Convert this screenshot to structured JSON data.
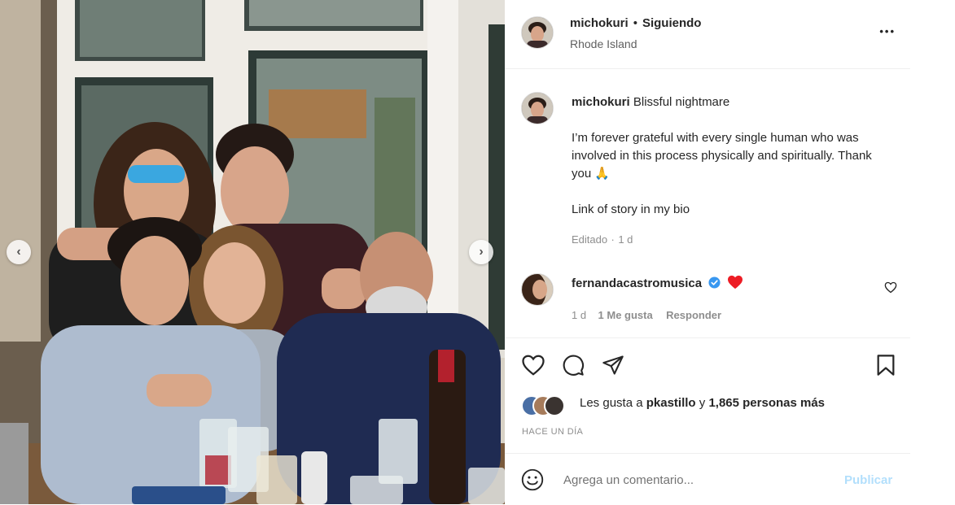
{
  "post": {
    "header": {
      "username": "michokuri",
      "separator": "•",
      "follow_status": "Siguiendo",
      "location": "Rhode Island",
      "more_icon": "more-horizontal-icon",
      "more_label": "•••"
    },
    "caption": {
      "username": "michokuri",
      "title": "Blissful nightmare",
      "paragraph": "I’m forever grateful with every single human who was involved in this process physically and spiritually. Thank you 🙏",
      "line2": "Link of story in my bio",
      "edited": "Editado",
      "meta_sep": "·",
      "age": "1 d"
    },
    "comment": {
      "username": "fernandacastromusica",
      "verified_icon": "verified-badge-icon",
      "text": "❤️",
      "age": "1 d",
      "likes": "1 Me gusta",
      "reply": "Responder"
    },
    "likes": {
      "prefix": "Les gusta a",
      "user": "pkastillo",
      "connector": "y",
      "count": "1,865 personas más"
    },
    "time_ago": "HACE UN DÍA",
    "comment_box": {
      "placeholder": "Agrega un comentario...",
      "publish": "Publicar"
    }
  },
  "colors": {
    "verified": "#3897f0",
    "heart_red": "#ed1c24",
    "publish_disabled": "#b2dffc",
    "secondary_text": "#8e8e8e"
  }
}
